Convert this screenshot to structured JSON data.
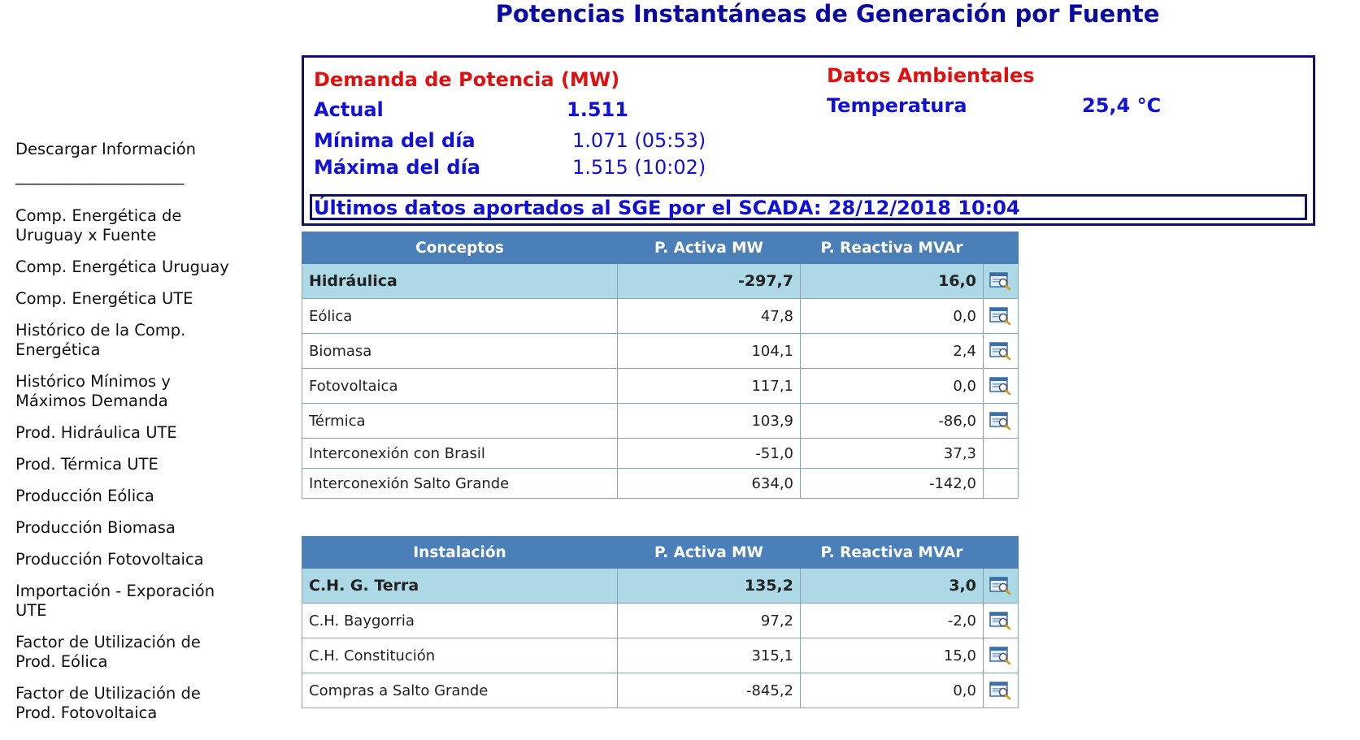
{
  "page": {
    "title": "Potencias Instantáneas de Generación por Fuente"
  },
  "sidebar": {
    "download": "Descargar Información",
    "divider": "_______________________",
    "items": [
      {
        "label": "Comp. Energética de Uruguay x Fuente"
      },
      {
        "label": "Comp. Energética Uruguay"
      },
      {
        "label": "Comp. Energética UTE"
      },
      {
        "label": "Histórico de la Comp. Energética"
      },
      {
        "label": "Histórico Mínimos y Máximos Demanda"
      },
      {
        "label": "Prod. Hidráulica UTE"
      },
      {
        "label": "Prod. Térmica UTE"
      },
      {
        "label": "Producción Eólica"
      },
      {
        "label": "Producción Biomasa"
      },
      {
        "label": "Producción Fotovoltaica"
      },
      {
        "label": "Importación - Exporación UTE"
      },
      {
        "label": "Factor de Utilización de Prod. Eólica"
      },
      {
        "label": "Factor de Utilización de Prod. Fotovoltaica"
      }
    ]
  },
  "demand": {
    "heading": "Demanda de Potencia (MW)",
    "actual_label": "Actual",
    "actual_value": "1.511",
    "min_label": "Mínima del día",
    "min_value": "1.071 (05:53)",
    "max_label": "Máxima del día",
    "max_value": "1.515 (10:02)"
  },
  "ambient": {
    "heading": "Datos Ambientales",
    "temp_label": "Temperatura",
    "temp_value": "25,4 °C"
  },
  "scada": {
    "text": "Últimos datos aportados al SGE por el SCADA: 28/12/2018 10:04"
  },
  "table_fuente": {
    "headers": [
      "Conceptos",
      "P. Activa MW",
      "P. Reactiva MVAr"
    ],
    "rows": [
      {
        "name": "Hidráulica",
        "activa": "-297,7",
        "reactiva": "16,0"
      },
      {
        "name": "Eólica",
        "activa": "47,8",
        "reactiva": "0,0"
      },
      {
        "name": "Biomasa",
        "activa": "104,1",
        "reactiva": "2,4"
      },
      {
        "name": "Fotovoltaica",
        "activa": "117,1",
        "reactiva": "0,0"
      },
      {
        "name": "Térmica",
        "activa": "103,9",
        "reactiva": "-86,0"
      },
      {
        "name": "Interconexión con Brasil",
        "activa": "-51,0",
        "reactiva": "37,3"
      },
      {
        "name": "Interconexión Salto Grande",
        "activa": "634,0",
        "reactiva": "-142,0"
      }
    ]
  },
  "table_instalacion": {
    "headers": [
      "Instalación",
      "P. Activa MW",
      "P. Reactiva MVAr"
    ],
    "rows": [
      {
        "name": "C.H. G. Terra",
        "activa": "135,2",
        "reactiva": "3,0"
      },
      {
        "name": "C.H. Baygorria",
        "activa": "97,2",
        "reactiva": "-2,0"
      },
      {
        "name": "C.H. Constitución",
        "activa": "315,1",
        "reactiva": "15,0"
      },
      {
        "name": "Compras a Salto Grande",
        "activa": "-845,2",
        "reactiva": "0,0"
      }
    ]
  },
  "icons": {
    "detail": "chart-window-search-icon"
  }
}
